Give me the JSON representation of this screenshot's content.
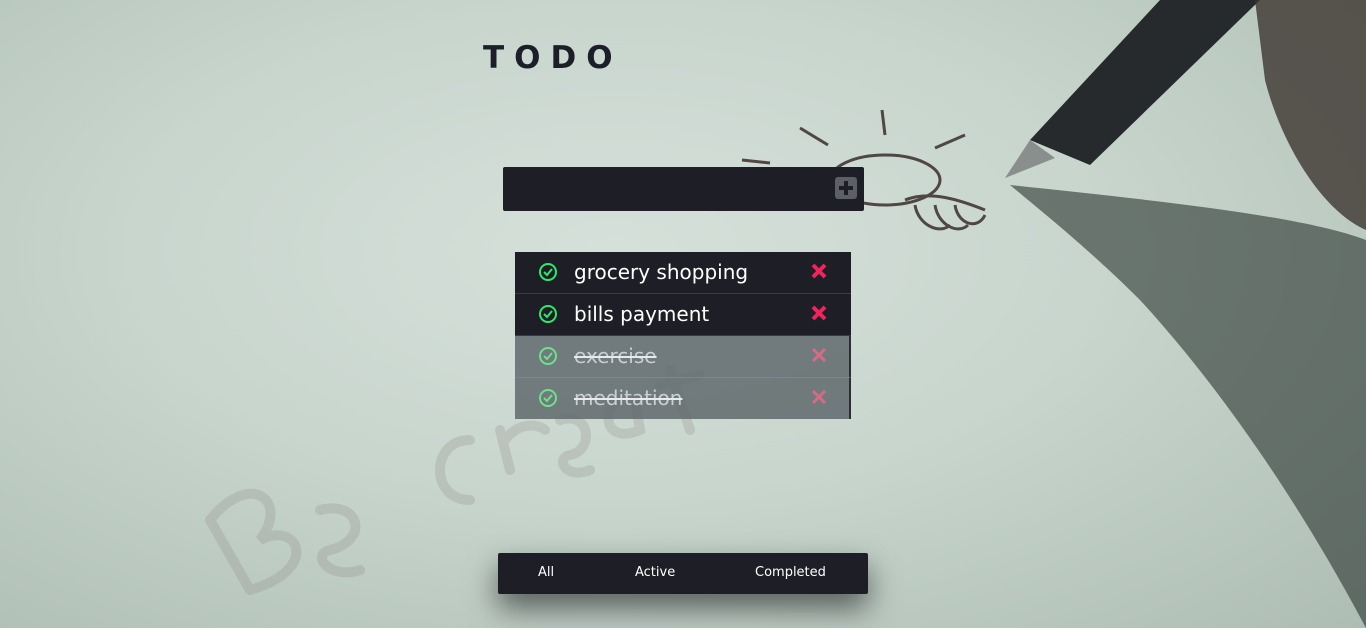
{
  "app": {
    "title": "TODO"
  },
  "new_todo": {
    "value": "",
    "placeholder": "",
    "add_icon": "plus-icon"
  },
  "todos": [
    {
      "text": "grocery shopping",
      "completed": false,
      "check_icon": "check-circle-icon",
      "delete_icon": "close-icon"
    },
    {
      "text": "bills payment",
      "completed": false,
      "check_icon": "check-circle-icon",
      "delete_icon": "close-icon"
    },
    {
      "text": "exercise",
      "completed": true,
      "check_icon": "check-circle-icon",
      "delete_icon": "close-icon"
    },
    {
      "text": "meditation",
      "completed": true,
      "check_icon": "check-circle-icon",
      "delete_icon": "close-icon"
    }
  ],
  "filters": {
    "all": "All",
    "active": "Active",
    "completed": "Completed"
  },
  "colors": {
    "panel": "#1e1f26",
    "check": "#2ee86a",
    "delete": "#f0245a",
    "title": "#1d1f28"
  }
}
